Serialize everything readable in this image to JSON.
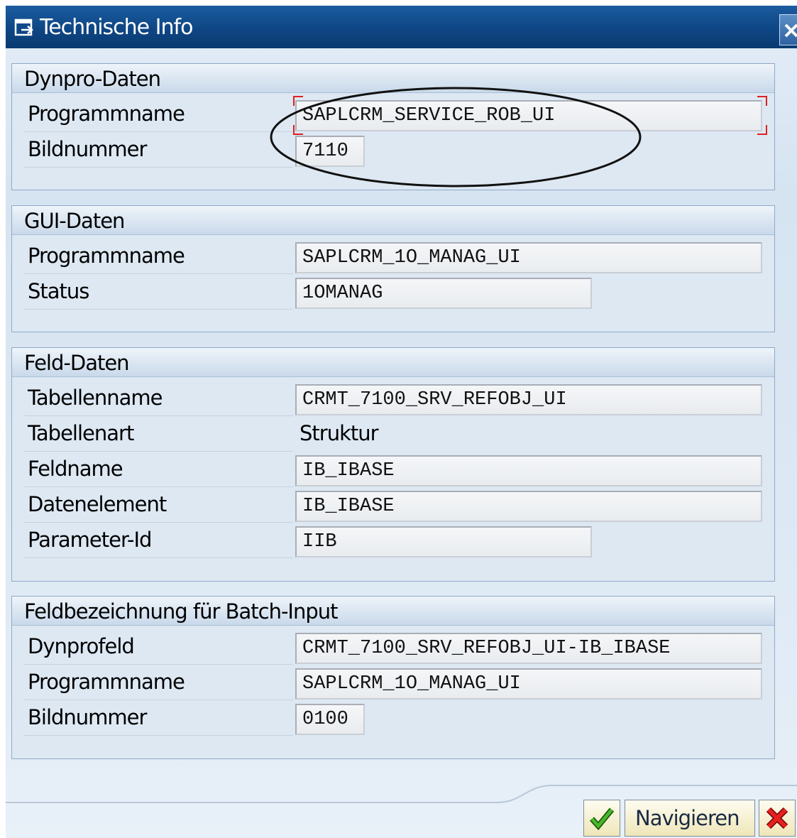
{
  "window": {
    "title": "Technische Info",
    "title_icon": "window-link-icon",
    "close_icon": "close-x-icon"
  },
  "groups": {
    "dynpro": {
      "title": "Dynpro-Daten",
      "rows": [
        {
          "label": "Programmname",
          "value": "SAPLCRM_SERVICE_ROB_UI"
        },
        {
          "label": "Bildnummer",
          "value": "7110"
        }
      ]
    },
    "gui": {
      "title": "GUI-Daten",
      "rows": [
        {
          "label": "Programmname",
          "value": "SAPLCRM_1O_MANAG_UI"
        },
        {
          "label": "Status",
          "value": "1OMANAG"
        }
      ]
    },
    "feld": {
      "title": "Feld-Daten",
      "rows": [
        {
          "label": "Tabellenname",
          "value": "CRMT_7100_SRV_REFOBJ_UI"
        },
        {
          "label": "Tabellenart",
          "value": "Struktur"
        },
        {
          "label": "Feldname",
          "value": "IB_IBASE"
        },
        {
          "label": "Datenelement",
          "value": "IB_IBASE"
        },
        {
          "label": "Parameter-Id",
          "value": "IIB"
        }
      ]
    },
    "batch": {
      "title": "Feldbezeichnung für Batch-Input",
      "rows": [
        {
          "label": "Dynprofeld",
          "value": "CRMT_7100_SRV_REFOBJ_UI-IB_IBASE"
        },
        {
          "label": "Programmname",
          "value": "SAPLCRM_1O_MANAG_UI"
        },
        {
          "label": "Bildnummer",
          "value": "0100"
        }
      ]
    }
  },
  "footer": {
    "ok_icon": "checkmark-icon",
    "navigate_label": "Navigieren",
    "cancel_icon": "cancel-x-icon"
  },
  "colors": {
    "titlebar": "#0e4684",
    "focus_corner": "#e02020",
    "ok_green": "#2e9a16",
    "cancel_red": "#e01818"
  }
}
